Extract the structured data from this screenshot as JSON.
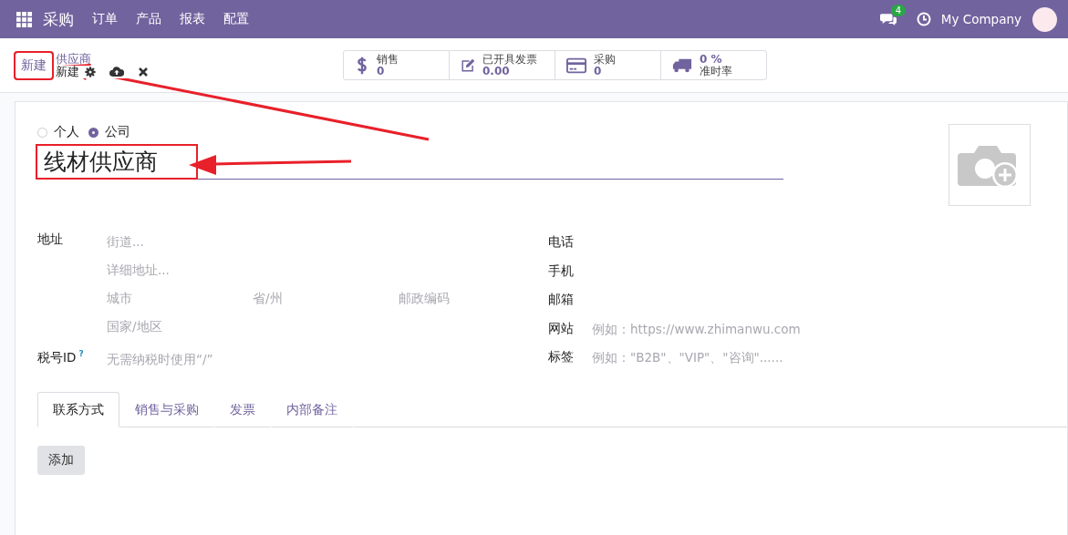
{
  "navbar": {
    "app": "采购",
    "menus": [
      "订单",
      "产品",
      "报表",
      "配置"
    ],
    "message_count": "4",
    "company": "My Company"
  },
  "control_panel": {
    "new_button": {
      "label": "新建",
      "highlighted": true
    },
    "breadcrumb": {
      "parent": "供应商",
      "current": "新建"
    }
  },
  "stat_buttons": [
    {
      "kind": "dollar",
      "label": "销售",
      "value": "0"
    },
    {
      "kind": "invoice",
      "label": "已开具发票",
      "value": "0.00"
    },
    {
      "kind": "card",
      "label": "采购",
      "value": "0"
    },
    {
      "kind": "truck",
      "label": "准时率",
      "value": "0 %"
    }
  ],
  "form": {
    "company_type": [
      {
        "label": "个人",
        "selected": false
      },
      {
        "label": "公司",
        "selected": true
      }
    ],
    "name": {
      "value": "线材供应商",
      "highlighted": true
    },
    "address": {
      "label": "地址",
      "street_placeholder": "街道...",
      "street2_placeholder": "详细地址...",
      "city_placeholder": "城市",
      "state_placeholder": "省/州",
      "zip_placeholder": "邮政编码",
      "country_placeholder": "国家/地区"
    },
    "vat": {
      "label": "税号ID",
      "help": "?",
      "placeholder": "无需纳税时使用“/”"
    },
    "right_fields": [
      {
        "label": "电话"
      },
      {
        "label": "手机"
      },
      {
        "label": "邮箱"
      },
      {
        "label": "网站",
        "placeholder": "例如：https://www.zhimanwu.com"
      },
      {
        "label": "标签",
        "placeholder": "例如：\"B2B\"、\"VIP\"、\"咨询\"......"
      }
    ]
  },
  "tabs": [
    {
      "label": "联系方式",
      "selected": true
    },
    {
      "label": "销售与采购",
      "selected": false
    },
    {
      "label": "发票",
      "selected": false
    },
    {
      "label": "内部备注",
      "selected": false
    }
  ],
  "add_button": "添加"
}
